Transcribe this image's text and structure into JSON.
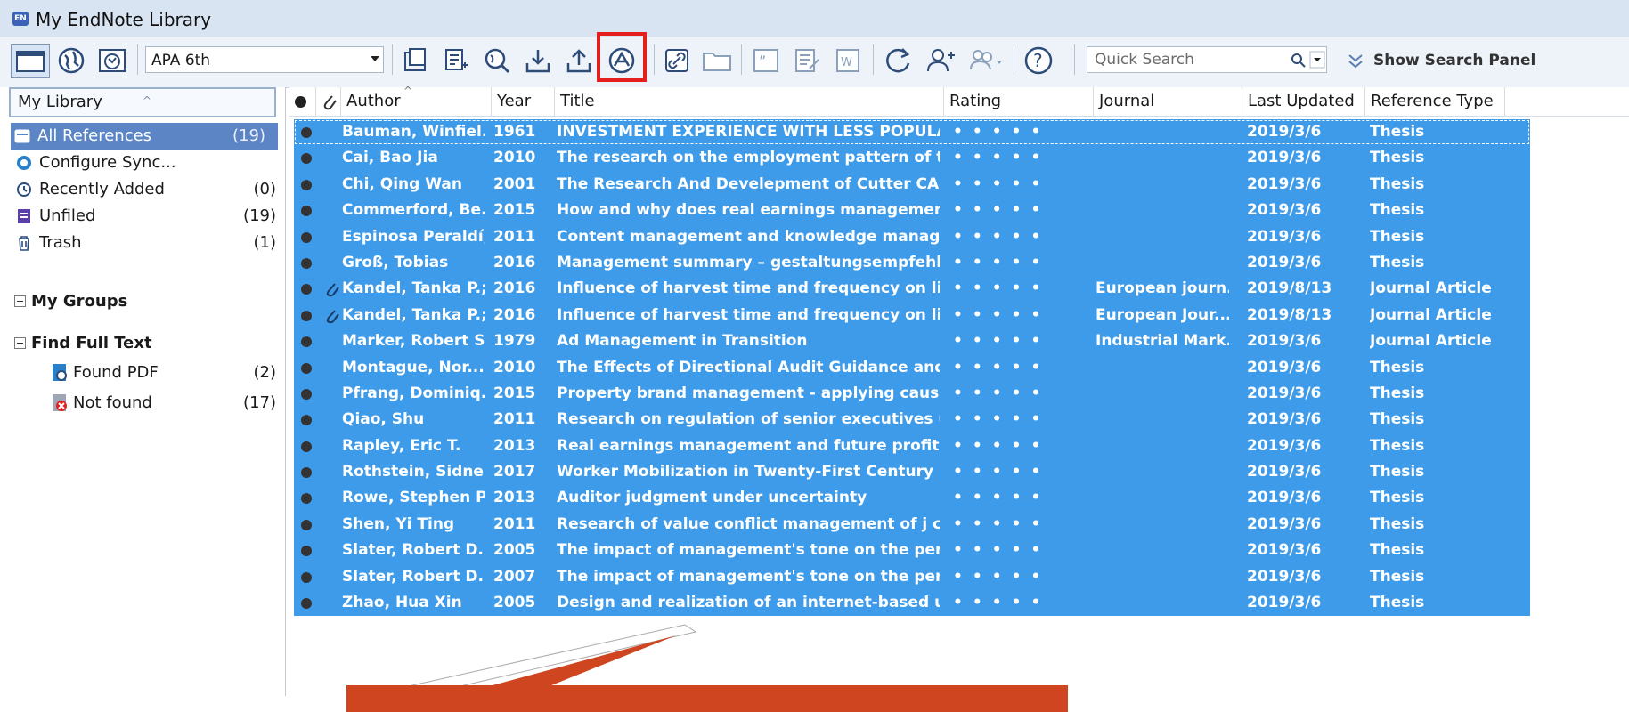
{
  "window": {
    "title": "My EndNote Library",
    "app_icon_text": "EN"
  },
  "toolbar": {
    "style_value": "APA 6th",
    "quick_search_placeholder": "Quick Search",
    "show_search_panel": "Show Search Panel",
    "icons": [
      "local-library-icon",
      "online-search-icon",
      "integrated-library-icon",
      "new-reference-icon",
      "new-note-icon",
      "online-search-world-icon",
      "import-icon",
      "export-icon",
      "find-full-text-icon",
      "open-link-icon",
      "open-file-icon",
      "insert-citation-icon",
      "format-bibliography-icon",
      "word-icon",
      "sync-icon",
      "share-group-icon",
      "share-icon",
      "help-icon"
    ]
  },
  "leftpane": {
    "header": "My Library",
    "groups": [
      {
        "label": "All References",
        "count": "(19)",
        "icon": "all-references-icon"
      },
      {
        "label": "Configure Sync...",
        "count": "",
        "icon": "sync-icon"
      },
      {
        "label": "Recently Added",
        "count": "(0)",
        "icon": "recent-icon"
      },
      {
        "label": "Unfiled",
        "count": "(19)",
        "icon": "unfiled-icon"
      },
      {
        "label": "Trash",
        "count": "(1)",
        "icon": "trash-icon"
      }
    ],
    "my_groups": "My Groups",
    "find_full_text": "Find Full Text",
    "fft_items": [
      {
        "label": "Found PDF",
        "count": "(2)"
      },
      {
        "label": "Not found",
        "count": "(17)"
      }
    ]
  },
  "columns": [
    "Author",
    "Year",
    "Title",
    "Rating",
    "Journal",
    "Last Updated",
    "Reference Type"
  ],
  "rows": [
    {
      "author": "Bauman, Winfiel...",
      "year": "1961",
      "title": "INVESTMENT EXPERIENCE WITH LESS POPULA...",
      "rating": "•••••",
      "journal": "",
      "updated": "2019/3/6",
      "type": "Thesis",
      "attach": false
    },
    {
      "author": "Cai, Bao Jia",
      "year": "2010",
      "title": "The research on the employment pattern of t...",
      "rating": "•••••",
      "journal": "",
      "updated": "2019/3/6",
      "type": "Thesis",
      "attach": false
    },
    {
      "author": "Chi, Qing Wan",
      "year": "2001",
      "title": "The Research And Develepment of Cutter CA...",
      "rating": "•••••",
      "journal": "",
      "updated": "2019/3/6",
      "type": "Thesis",
      "attach": false
    },
    {
      "author": "Commerford, Be...",
      "year": "2015",
      "title": "How and why does real earnings management ...",
      "rating": "•••••",
      "journal": "",
      "updated": "2019/3/6",
      "type": "Thesis",
      "attach": false
    },
    {
      "author": "Espinosa Peraldí, ...",
      "year": "2011",
      "title": "Content management and knowledge manage...",
      "rating": "•••••",
      "journal": "",
      "updated": "2019/3/6",
      "type": "Thesis",
      "attach": false
    },
    {
      "author": "Groß, Tobias",
      "year": "2016",
      "title": "Management summary – gestaltungsempfehlu...",
      "rating": "•••••",
      "journal": "",
      "updated": "2019/3/6",
      "type": "Thesis",
      "attach": false
    },
    {
      "author": "Kandel, Tanka P.;...",
      "year": "2016",
      "title": "Influence of harvest time and frequency on lig...",
      "rating": "•••••",
      "journal": "European journ...",
      "updated": "2019/8/13",
      "type": "Journal Article",
      "attach": true
    },
    {
      "author": "Kandel, Tanka P.;...",
      "year": "2016",
      "title": "Influence of harvest time and frequency on lig...",
      "rating": "•••••",
      "journal": "European Jour...",
      "updated": "2019/8/13",
      "type": "Journal Article",
      "attach": true
    },
    {
      "author": "Marker, Robert S.",
      "year": "1979",
      "title": "Ad Management in Transition",
      "rating": "•••••",
      "journal": "Industrial Mark...",
      "updated": "2019/3/6",
      "type": "Journal Article",
      "attach": false
    },
    {
      "author": "Montague, Nor...",
      "year": "2010",
      "title": "The Effects of Directional Audit Guidance and ...",
      "rating": "•••••",
      "journal": "",
      "updated": "2019/3/6",
      "type": "Thesis",
      "attach": false
    },
    {
      "author": "Pfrang, Dominiq...",
      "year": "2015",
      "title": "Property brand management - applying causal ...",
      "rating": "•••••",
      "journal": "",
      "updated": "2019/3/6",
      "type": "Thesis",
      "attach": false
    },
    {
      "author": "Qiao, Shu",
      "year": "2011",
      "title": "Research on regulation of senior executives u...",
      "rating": "•••••",
      "journal": "",
      "updated": "2019/3/6",
      "type": "Thesis",
      "attach": false
    },
    {
      "author": "Rapley, Eric T.",
      "year": "2013",
      "title": "Real earnings management and future profita...",
      "rating": "•••••",
      "journal": "",
      "updated": "2019/3/6",
      "type": "Thesis",
      "attach": false
    },
    {
      "author": "Rothstein, Sidne...",
      "year": "2017",
      "title": "Worker Mobilization in Twenty-First Century L...",
      "rating": "•••••",
      "journal": "",
      "updated": "2019/3/6",
      "type": "Thesis",
      "attach": false
    },
    {
      "author": "Rowe, Stephen P.",
      "year": "2013",
      "title": "Auditor judgment under uncertainty",
      "rating": "•••••",
      "journal": "",
      "updated": "2019/3/6",
      "type": "Thesis",
      "attach": false
    },
    {
      "author": "Shen, Yi Ting",
      "year": "2011",
      "title": "Research of value conflict management of j co...",
      "rating": "•••••",
      "journal": "",
      "updated": "2019/3/6",
      "type": "Thesis",
      "attach": false
    },
    {
      "author": "Slater, Robert D...",
      "year": "2005",
      "title": "The impact of management's tone on the perc...",
      "rating": "•••••",
      "journal": "",
      "updated": "2019/3/6",
      "type": "Thesis",
      "attach": false
    },
    {
      "author": "Slater, Robert D....",
      "year": "2007",
      "title": "The impact of management's tone on the perc...",
      "rating": "•••••",
      "journal": "",
      "updated": "2019/3/6",
      "type": "Thesis",
      "attach": false
    },
    {
      "author": "Zhao, Hua Xin",
      "year": "2005",
      "title": "Design and realization of an internet-based uni...",
      "rating": "•••••",
      "journal": "",
      "updated": "2019/3/6",
      "type": "Thesis",
      "attach": false
    }
  ],
  "colors": {
    "selection": "#3e9be9",
    "highlight": "#e41d1d",
    "callout": "#cf4520",
    "sidebar_selected": "#5b85c4"
  }
}
